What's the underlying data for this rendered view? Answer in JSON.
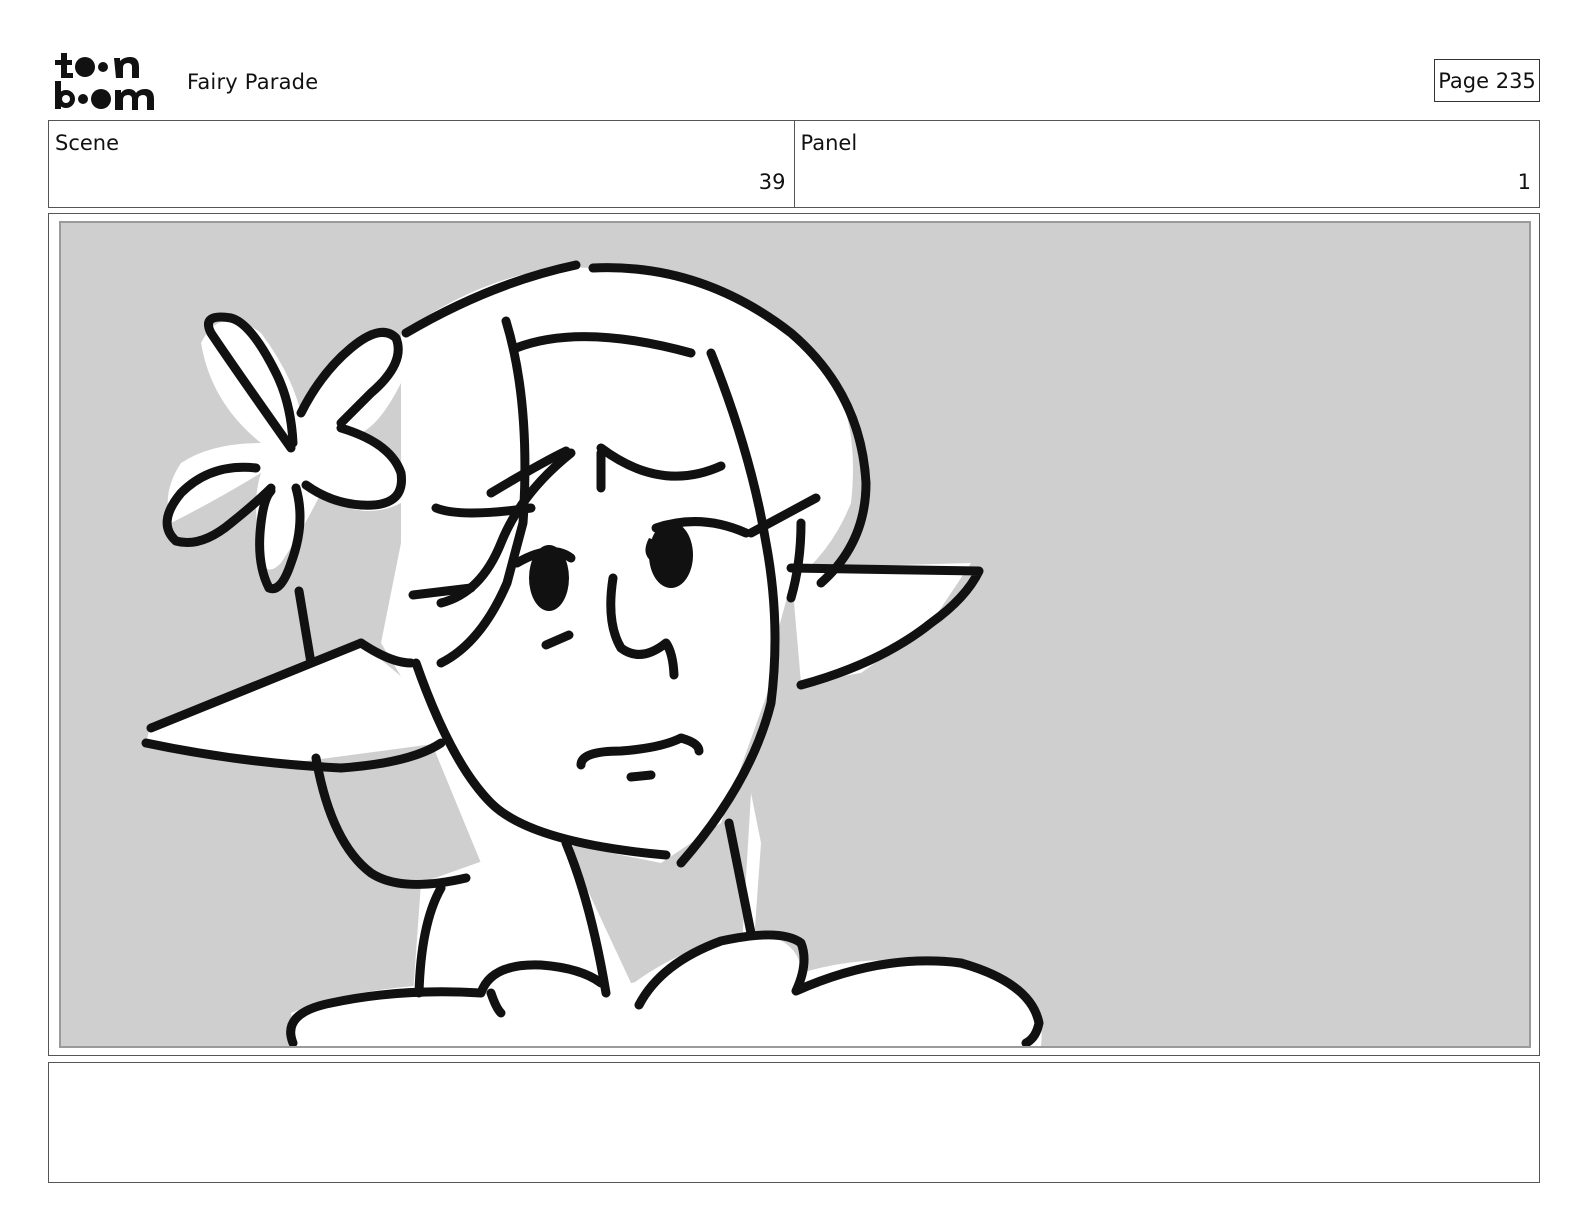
{
  "header": {
    "logo_text": "toon boom",
    "project_title": "Fairy Parade",
    "page_label": "Page 235"
  },
  "scene": {
    "label": "Scene",
    "value": "39"
  },
  "panel": {
    "label": "Panel",
    "value": "1"
  },
  "panel_image": {
    "background_color": "#cfcfcf",
    "line_color": "#111111"
  },
  "notes": {
    "text": ""
  }
}
